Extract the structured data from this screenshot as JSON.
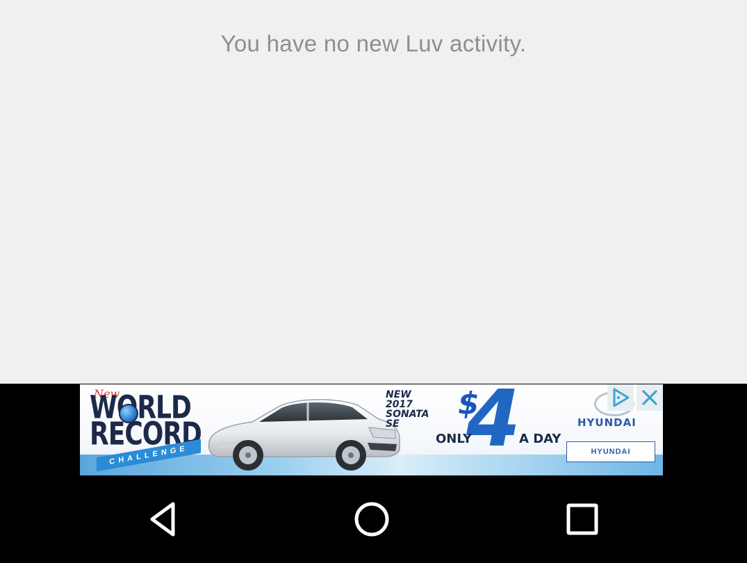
{
  "activity": {
    "empty_message": "You have no new Luv activity."
  },
  "ad": {
    "logo_script": "New",
    "logo_line1": "WORLD",
    "logo_line2": "RECORD",
    "logo_ribbon": "CHALLENGE",
    "headline": "NEW 2017 SONATA SE",
    "price_symbol": "$",
    "price_value": "4",
    "price_prefix": "ONLY",
    "price_suffix": "A DAY",
    "brand": "HYUNDAI",
    "dealer": "HYUNDAI",
    "choices_icon": "ad-choices-icon",
    "close_icon": "close-icon"
  },
  "navigation": {
    "back_icon": "back-icon",
    "home_icon": "home-icon",
    "recents_icon": "recents-icon"
  },
  "colors": {
    "background": "#f0f0f0",
    "message_text": "#8a8f96",
    "system_bar": "#000000",
    "ad_accent": "#2266c4"
  }
}
